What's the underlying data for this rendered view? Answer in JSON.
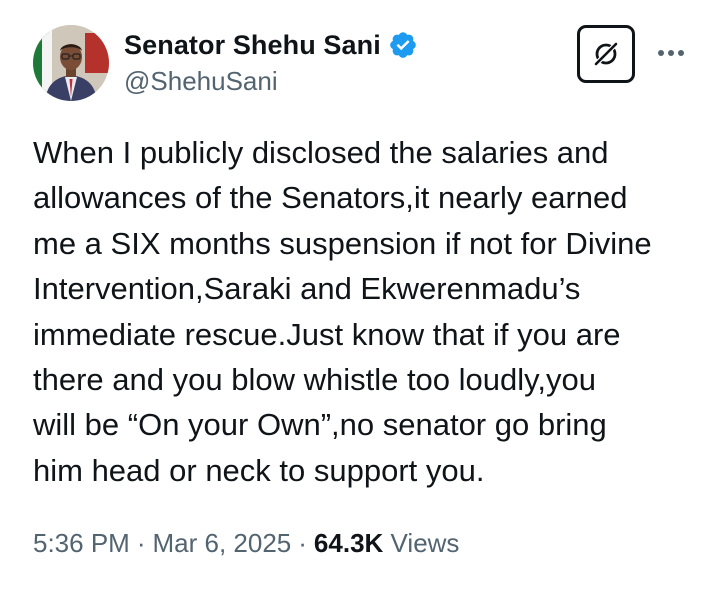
{
  "author": {
    "display_name": "Senator Shehu Sani",
    "handle": "@ShehuSani",
    "verified": true,
    "verified_color": "#1d9bf0",
    "avatar_icon": "profile-photo"
  },
  "actions": {
    "grok_icon": "grok-icon",
    "more_icon": "more-dots-icon"
  },
  "tweet": {
    "text": "When I publicly disclosed the salaries and\nallowances of the Senators,it nearly earned\nme a SIX months suspension if not for Divine\nIntervention,Saraki and Ekwerenmadu’s\nimmediate rescue.Just know that if you are\nthere and you blow whistle too loudly,you\nwill be “On your Own”,no senator go bring\nhim head or neck to support you."
  },
  "meta": {
    "time": "5:36 PM",
    "separator": "·",
    "date": "Mar 6, 2025",
    "views_count": "64.3K",
    "views_label": "Views"
  },
  "colors": {
    "text_primary": "#0f1419",
    "text_secondary": "#536471",
    "background": "#ffffff"
  }
}
